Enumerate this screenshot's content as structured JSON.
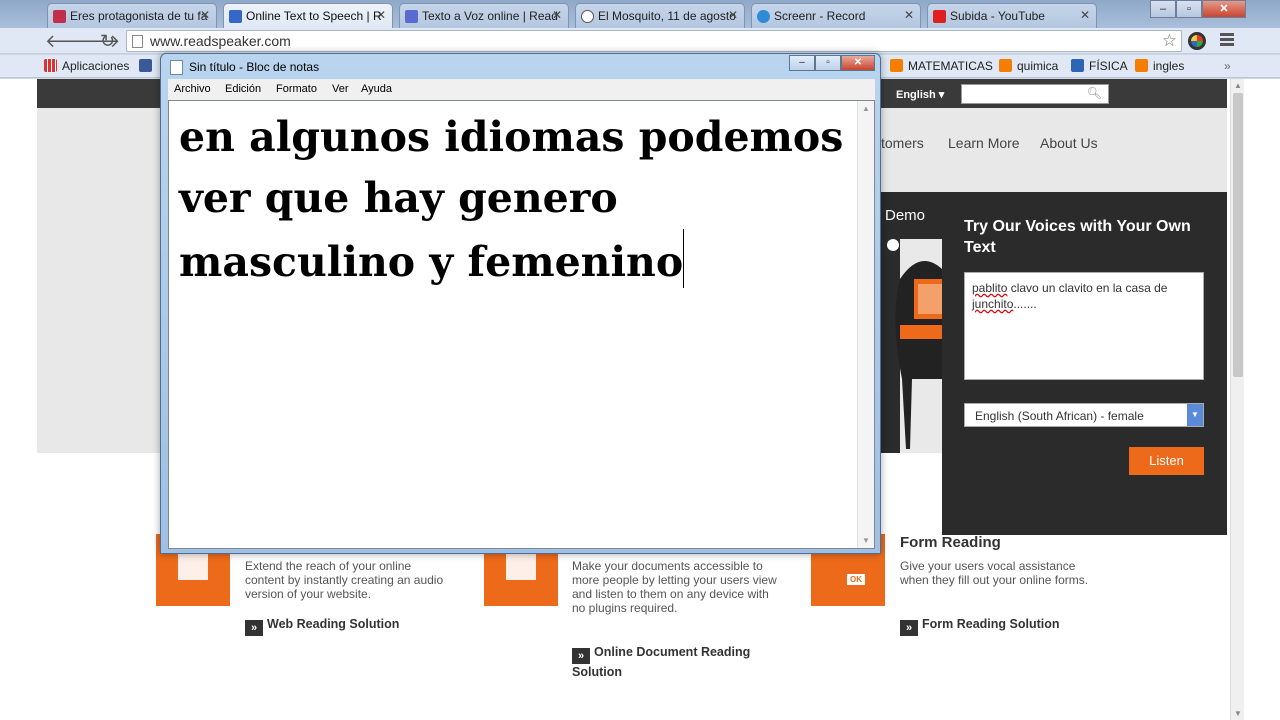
{
  "browser": {
    "tabs": [
      {
        "title": "Eres protagonista de tu fa",
        "icon_color": "#c0304a"
      },
      {
        "title": "Online Text to Speech | R",
        "icon_color": "#3467c8"
      },
      {
        "title": "Texto a Voz online | Read",
        "icon_color": "#5a6bd0"
      },
      {
        "title": "El Mosquito, 11 de agosto",
        "icon_color": "#555555"
      },
      {
        "title": "Screenr - Record",
        "icon_color": "#2f8ad8"
      },
      {
        "title": "Subida - YouTube",
        "icon_color": "#e02020"
      }
    ],
    "active_tab_index": 1,
    "url": "www.readspeaker.com",
    "window_controls": {
      "minimize": "–",
      "maximize": "▫",
      "close": "✕"
    },
    "bookmarks": {
      "apps": "Aplicaciones",
      "items": [
        "MATEMATICAS",
        "quimica",
        "FÍSICA",
        "ingles"
      ],
      "overflow": "»"
    }
  },
  "site": {
    "language": "English ▾",
    "nav": [
      "tomers",
      "Learn More",
      "About Us"
    ],
    "demo_label": "Demo",
    "voice_panel": {
      "title": "Try Our Voices with Your Own Text",
      "text_line1_prefix": "",
      "text_word1": "pablito",
      "text_rest1": " clavo un clavito en la casa de",
      "text_word2": "junchito",
      "text_rest2": ".......",
      "voice_selected": "English (South African) - female",
      "listen_button": "Listen"
    },
    "features": [
      {
        "title": "",
        "desc": "Extend the reach of your online content by instantly creating an audio version of your website.",
        "link": "Web Reading Solution"
      },
      {
        "title": "",
        "desc": "Make your documents accessible to more people by letting your users view and listen to them on any device with no plugins required.",
        "link": "Online Document Reading Solution"
      },
      {
        "title": "Form Reading",
        "desc": "Give your users vocal assistance when they fill out your online forms.",
        "link": "Form Reading Solution",
        "badge": "OK"
      }
    ],
    "link_glyph": "»"
  },
  "notepad": {
    "title": "Sin título - Bloc de notas",
    "menu": [
      "Archivo",
      "Edición",
      "Formato",
      "Ver",
      "Ayuda"
    ],
    "content": "en algunos idiomas podemos ver que hay genero masculino y femenino"
  },
  "colors": {
    "accent_orange": "#ed6a1a",
    "panel_dark": "#2b2b2b"
  }
}
